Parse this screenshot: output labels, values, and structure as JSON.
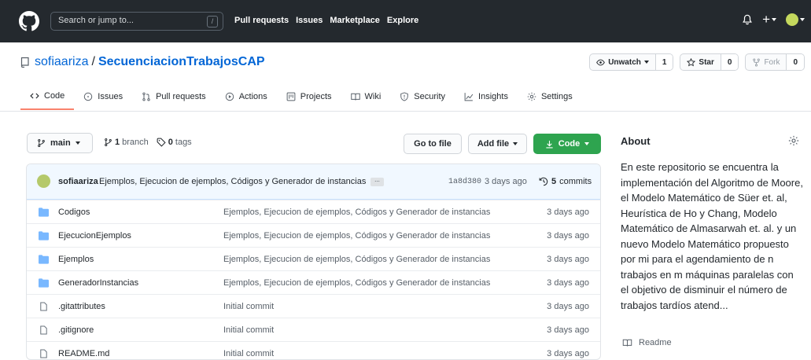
{
  "navbar": {
    "search_placeholder": "Search or jump to...",
    "search_shortcut": "/",
    "links": [
      "Pull requests",
      "Issues",
      "Marketplace",
      "Explore"
    ]
  },
  "repo": {
    "owner": "sofiaariza",
    "separator": "/",
    "name": "SecuenciacionTrabajosCAP",
    "watch_label": "Unwatch",
    "watch_count": "1",
    "star_label": "Star",
    "star_count": "0",
    "fork_label": "Fork",
    "fork_count": "0"
  },
  "tabs": [
    {
      "label": "Code",
      "icon": "code-icon",
      "selected": true
    },
    {
      "label": "Issues",
      "icon": "issue-icon"
    },
    {
      "label": "Pull requests",
      "icon": "pull-request-icon"
    },
    {
      "label": "Actions",
      "icon": "play-icon"
    },
    {
      "label": "Projects",
      "icon": "project-icon"
    },
    {
      "label": "Wiki",
      "icon": "book-icon"
    },
    {
      "label": "Security",
      "icon": "shield-icon"
    },
    {
      "label": "Insights",
      "icon": "graph-icon"
    },
    {
      "label": "Settings",
      "icon": "gear-icon"
    }
  ],
  "branch_bar": {
    "branch": "main",
    "branch_count": "1",
    "branch_word": "branch",
    "tag_count": "0",
    "tag_word": "tags",
    "goto_file": "Go to file",
    "add_file": "Add file",
    "code": "Code"
  },
  "commit": {
    "author": "sofiaariza",
    "message": "Ejemplos, Ejecucion de ejemplos, Códigos y Generador de instancias",
    "ellipsis": "...",
    "sha": "1a8d380",
    "time": "3 days ago",
    "count": "5",
    "count_word": "commits"
  },
  "files": [
    {
      "type": "folder",
      "name": "Codigos",
      "message": "Ejemplos, Ejecucion de ejemplos, Códigos y Generador de instancias",
      "age": "3 days ago"
    },
    {
      "type": "folder",
      "name": "EjecucionEjemplos",
      "message": "Ejemplos, Ejecucion de ejemplos, Códigos y Generador de instancias",
      "age": "3 days ago"
    },
    {
      "type": "folder",
      "name": "Ejemplos",
      "message": "Ejemplos, Ejecucion de ejemplos, Códigos y Generador de instancias",
      "age": "3 days ago"
    },
    {
      "type": "folder",
      "name": "GeneradorInstancias",
      "message": "Ejemplos, Ejecucion de ejemplos, Códigos y Generador de instancias",
      "age": "3 days ago"
    },
    {
      "type": "file",
      "name": ".gitattributes",
      "message": "Initial commit",
      "age": "3 days ago"
    },
    {
      "type": "file",
      "name": ".gitignore",
      "message": "Initial commit",
      "age": "3 days ago"
    },
    {
      "type": "file",
      "name": "README.md",
      "message": "Initial commit",
      "age": "3 days ago"
    }
  ],
  "about": {
    "title": "About",
    "description": "En este repositorio se encuentra la implementación del Algoritmo de Moore, el Modelo Matemático de Süer et. al, Heurística de Ho y Chang, Modelo Matemático de Almasarwah et. al. y un nuevo Modelo Matemático propuesto por mi para el agendamiento de n trabajos en m máquinas paralelas con el objetivo de disminuir el número de trabajos tardíos atend...",
    "readme": "Readme"
  },
  "colors": {
    "navbar": "#24292e",
    "link": "#0366d6",
    "primary_button": "#2ea44f",
    "tab_underline": "#f9826c",
    "folder": "#79b8ff"
  }
}
